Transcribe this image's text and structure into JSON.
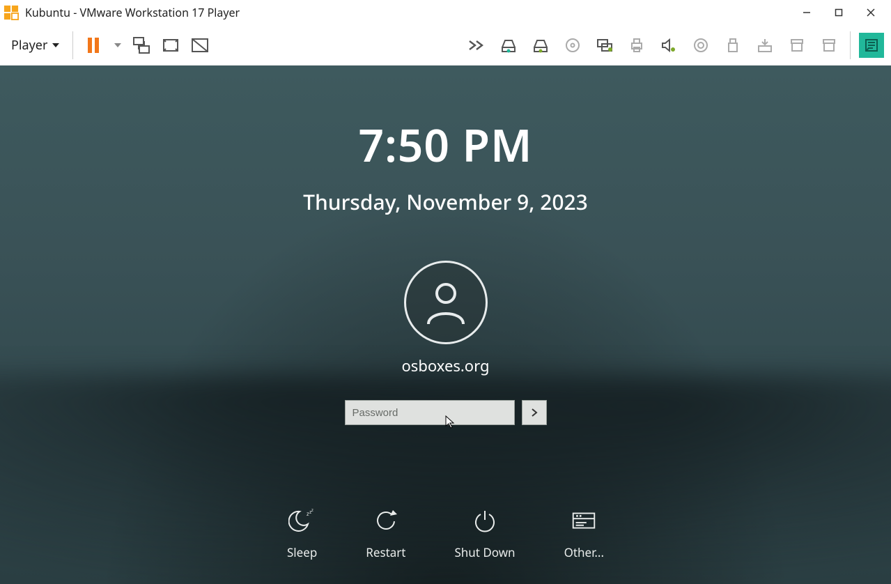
{
  "window": {
    "title": "Kubuntu - VMware Workstation 17 Player"
  },
  "toolbar": {
    "player_menu_label": "Player"
  },
  "lockscreen": {
    "time": "7:50 PM",
    "date": "Thursday, November 9, 2023",
    "username": "osboxes.org",
    "password_placeholder": "Password",
    "password_value": "",
    "actions": {
      "sleep": "Sleep",
      "restart": "Restart",
      "shutdown": "Shut Down",
      "other": "Other..."
    }
  }
}
